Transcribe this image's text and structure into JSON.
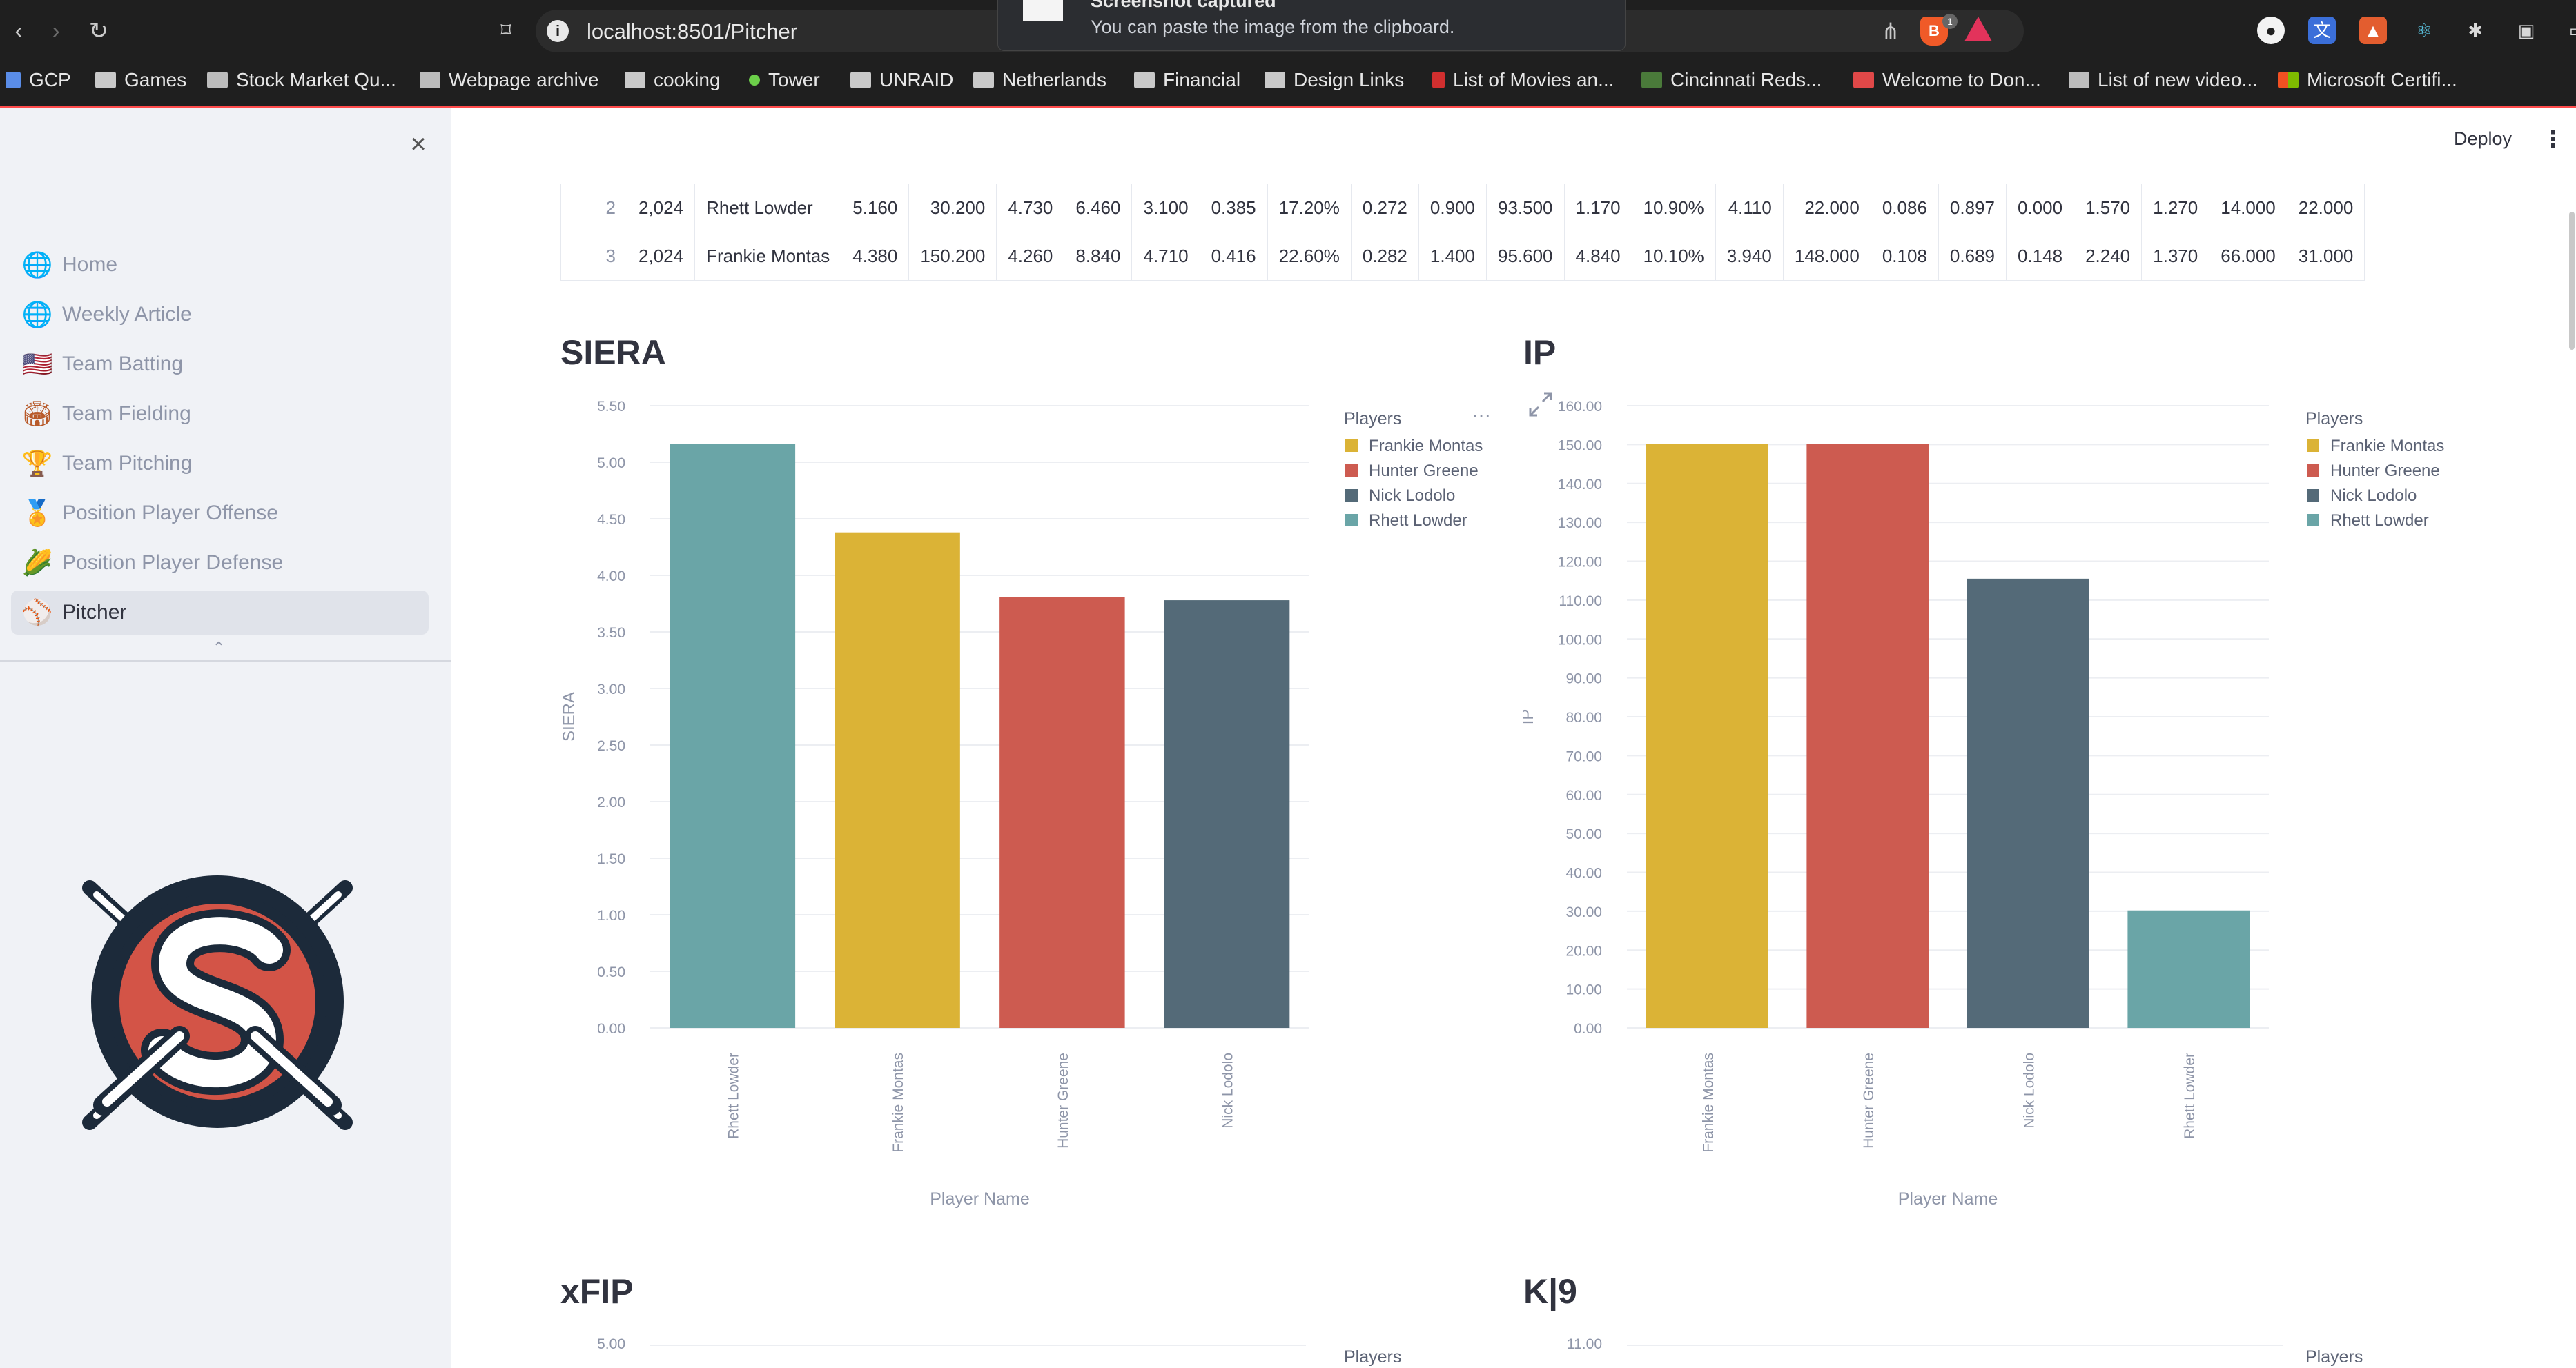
{
  "browser": {
    "url": "localhost:8501/Pitcher",
    "toast": {
      "title": "Screenshot captured",
      "message": "You can paste the image from the clipboard."
    },
    "bookmarks": [
      {
        "label": "GCP",
        "icon": "grid-icon"
      },
      {
        "label": "Games",
        "icon": "folder-icon"
      },
      {
        "label": "Stock Market Qu...",
        "icon": "ticker-icon"
      },
      {
        "label": "Webpage archive",
        "icon": "archive-icon"
      },
      {
        "label": "cooking",
        "icon": "folder-icon"
      },
      {
        "label": "Tower",
        "icon": "dot-icon"
      },
      {
        "label": "UNRAID",
        "icon": "folder-icon"
      },
      {
        "label": "Netherlands",
        "icon": "folder-icon"
      },
      {
        "label": "Financial",
        "icon": "folder-icon"
      },
      {
        "label": "Design Links",
        "icon": "folder-icon"
      },
      {
        "label": "List of Movies an...",
        "icon": "film-icon"
      },
      {
        "label": "Cincinnati Reds...",
        "icon": "reds-icon"
      },
      {
        "label": "Welcome to Don...",
        "icon": "d-icon"
      },
      {
        "label": "List of new video...",
        "icon": "game-icon"
      },
      {
        "label": "Microsoft Certifi...",
        "icon": "windows-icon"
      }
    ]
  },
  "app": {
    "deploy_label": "Deploy"
  },
  "sidebar": {
    "items": [
      {
        "label": "Home",
        "icon": "globe-icon"
      },
      {
        "label": "Weekly Article",
        "icon": "globe-icon"
      },
      {
        "label": "Team Batting",
        "icon": "us-flag-icon"
      },
      {
        "label": "Team Fielding",
        "icon": "stadium-icon"
      },
      {
        "label": "Team Pitching",
        "icon": "trophy-icon"
      },
      {
        "label": "Position Player Offense",
        "icon": "medal-icon"
      },
      {
        "label": "Position Player Defense",
        "icon": "corn-icon"
      },
      {
        "label": "Pitcher",
        "icon": "baseball-icon",
        "active": true
      }
    ]
  },
  "table": {
    "rows": [
      [
        "2",
        "2,024",
        "Rhett Lowder",
        "5.160",
        "30.200",
        "4.730",
        "6.460",
        "3.100",
        "0.385",
        "17.20%",
        "0.272",
        "0.900",
        "93.500",
        "1.170",
        "10.90%",
        "4.110",
        "22.000",
        "0.086",
        "0.897",
        "0.000",
        "1.570",
        "1.270",
        "14.000",
        "22.000"
      ],
      [
        "3",
        "2,024",
        "Frankie Montas",
        "4.380",
        "150.200",
        "4.260",
        "8.840",
        "4.710",
        "0.416",
        "22.60%",
        "0.282",
        "1.400",
        "95.600",
        "4.840",
        "10.10%",
        "3.940",
        "148.000",
        "0.108",
        "0.689",
        "0.148",
        "2.240",
        "1.370",
        "66.000",
        "31.000"
      ]
    ]
  },
  "colors": {
    "Frankie Montas": "#dbb336",
    "Hunter Greene": "#cd5b50",
    "Nick Lodolo": "#546a78",
    "Rhett Lowder": "#6aa5a7"
  },
  "chart_data": [
    {
      "type": "bar",
      "title": "SIERA",
      "xlabel": "Player Name",
      "ylabel": "SIERA",
      "categories": [
        "Rhett Lowder",
        "Frankie Montas",
        "Hunter Greene",
        "Nick Lodolo"
      ],
      "values": [
        5.16,
        4.38,
        3.81,
        3.78
      ],
      "ylim": [
        0,
        5.5
      ],
      "yticks": [
        "0.00",
        "0.50",
        "1.00",
        "1.50",
        "2.00",
        "2.50",
        "3.00",
        "3.50",
        "4.00",
        "4.50",
        "5.00",
        "5.50"
      ],
      "legend_title": "Players",
      "legend": [
        "Frankie Montas",
        "Hunter Greene",
        "Nick Lodolo",
        "Rhett Lowder"
      ],
      "legend_position": "right",
      "grid": true
    },
    {
      "type": "bar",
      "title": "IP",
      "xlabel": "Player Name",
      "ylabel": "IP",
      "categories": [
        "Frankie Montas",
        "Hunter Greene",
        "Nick Lodolo",
        "Rhett Lowder"
      ],
      "values": [
        150.2,
        150.2,
        115.5,
        30.2
      ],
      "ylim": [
        0,
        160
      ],
      "yticks": [
        "0.00",
        "10.00",
        "20.00",
        "30.00",
        "40.00",
        "50.00",
        "60.00",
        "70.00",
        "80.00",
        "90.00",
        "100.00",
        "110.00",
        "120.00",
        "130.00",
        "140.00",
        "150.00",
        "160.00"
      ],
      "legend_title": "Players",
      "legend": [
        "Frankie Montas",
        "Hunter Greene",
        "Nick Lodolo",
        "Rhett Lowder"
      ],
      "legend_position": "right",
      "grid": true
    },
    {
      "type": "bar",
      "title": "xFIP",
      "yticks": [
        "5.00"
      ],
      "legend_title": "Players"
    },
    {
      "type": "bar",
      "title": "K|9",
      "yticks": [
        "11.00"
      ],
      "legend_title": "Players"
    }
  ]
}
